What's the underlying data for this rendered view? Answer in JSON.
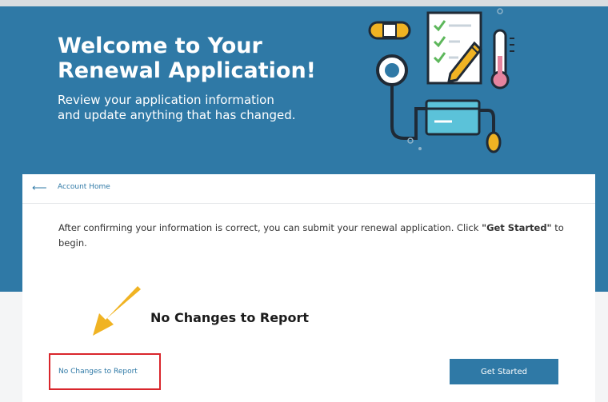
{
  "hero": {
    "title_line1": "Welcome to Your",
    "title_line2": "Renewal Application!",
    "subtitle_line1": "Review your application information",
    "subtitle_line2": "and update anything that has changed."
  },
  "breadcrumb": {
    "arrow": "⟵",
    "label": "Account Home"
  },
  "intro": {
    "text_before": "After confirming your information is correct, you can submit your renewal application. Click ",
    "text_bold": "\"Get Started\"",
    "text_after": " to begin."
  },
  "callout": {
    "label": "No Changes to Report"
  },
  "actions": {
    "no_changes_label": "No Changes to Report",
    "get_started_label": "Get Started"
  },
  "colors": {
    "primary": "#2f79a6",
    "highlight_box": "#d9262c",
    "callout_arrow": "#f0b323"
  },
  "icons": [
    "bandage-icon",
    "checklist-clipboard-icon",
    "pencil-icon",
    "thermometer-icon",
    "stethoscope-icon",
    "credit-card-icon",
    "callout-arrow-icon"
  ]
}
